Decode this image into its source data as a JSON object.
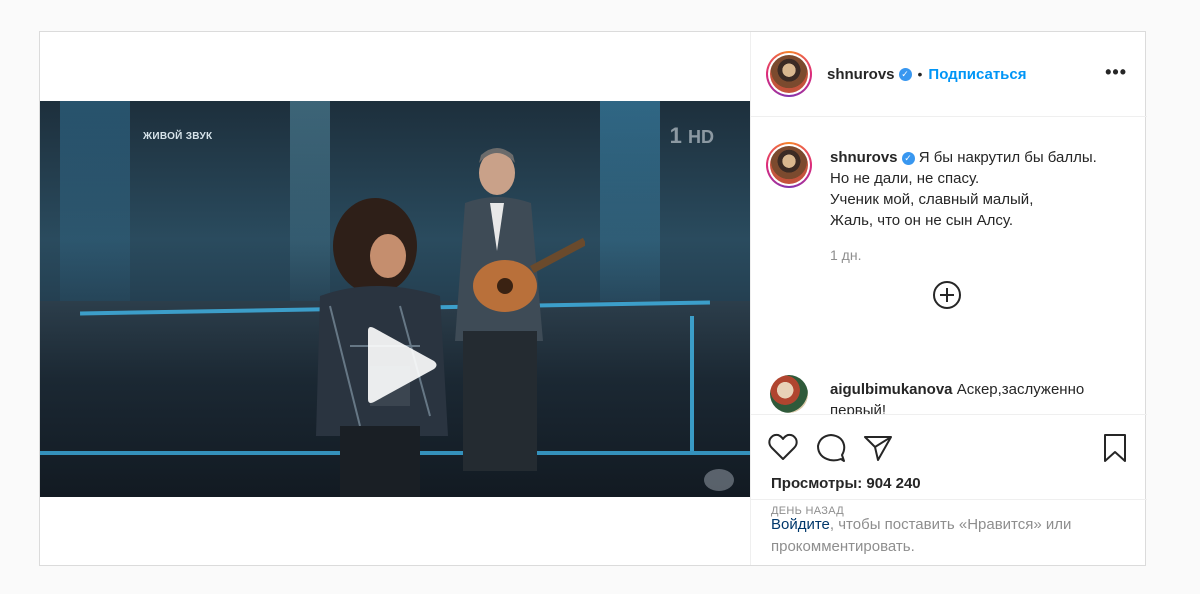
{
  "post": {
    "author": {
      "username": "shnurovs",
      "verified": true,
      "follow_label": "Подписаться",
      "more_label": "•••"
    },
    "video": {
      "overlay_text": "ЖИВОЙ ЗВУК",
      "channel_logo": "1",
      "channel_logo_hd": "HD"
    },
    "caption": {
      "username": "shnurovs",
      "lines": [
        "Я бы накрутил бы баллы.",
        "Но не дали, не спасу.",
        "Ученик мой, славный малый,",
        "Жаль, что он не сын Алсу."
      ],
      "time": "1 дн."
    },
    "comments": [
      {
        "username": "aigulbimukanova",
        "text_line1": "Аскер,заслуженно",
        "text_line2": "первый!"
      }
    ],
    "stats": {
      "views_label": "Просмотры: 904 240",
      "time_ago": "ДЕНЬ НАЗАД"
    },
    "login_prompt": {
      "link": "Войдите",
      "rest_line1": ", чтобы поставить «Нравится» или",
      "rest_line2": "прокомментировать."
    },
    "colors": {
      "accent": "#0095f6",
      "verified": "#3897f0",
      "link": "#00376b",
      "muted": "#8e8e8e"
    },
    "icons": [
      "play-icon",
      "heart-icon",
      "comment-icon",
      "share-icon",
      "bookmark-icon",
      "add-circle-icon",
      "more-icon",
      "verified-icon"
    ]
  }
}
